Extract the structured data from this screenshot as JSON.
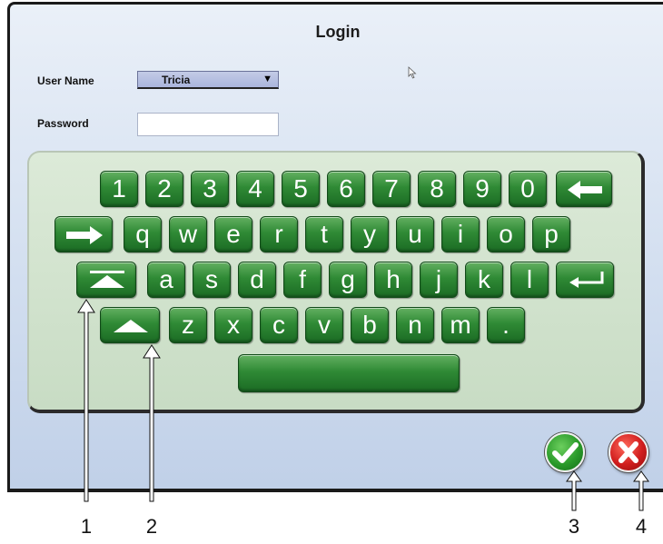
{
  "dialog": {
    "title": "Login",
    "user_name_label": "User Name",
    "user_name_value": "Tricia",
    "password_label": "Password",
    "password_value": ""
  },
  "keyboard": {
    "row1": [
      "1",
      "2",
      "3",
      "4",
      "5",
      "6",
      "7",
      "8",
      "9",
      "0"
    ],
    "row2": [
      "q",
      "w",
      "e",
      "r",
      "t",
      "y",
      "u",
      "i",
      "o",
      "p"
    ],
    "row3": [
      "a",
      "s",
      "d",
      "f",
      "g",
      "h",
      "j",
      "k",
      "l"
    ],
    "row4": [
      "z",
      "x",
      "c",
      "v",
      "b",
      "n",
      "m",
      "."
    ],
    "icons": {
      "backspace": "backspace-arrow-icon",
      "tab": "tab-arrow-icon",
      "caps_lock": "caps-lock-icon",
      "enter": "enter-icon",
      "shift": "shift-icon"
    }
  },
  "actions": {
    "ok_icon": "check-icon",
    "cancel_icon": "x-icon"
  },
  "callouts": [
    "1",
    "2",
    "3",
    "4"
  ],
  "colors": {
    "key_green": "#2f8a35",
    "ok_green": "#2a9a2a",
    "cancel_red": "#d01d1d"
  }
}
